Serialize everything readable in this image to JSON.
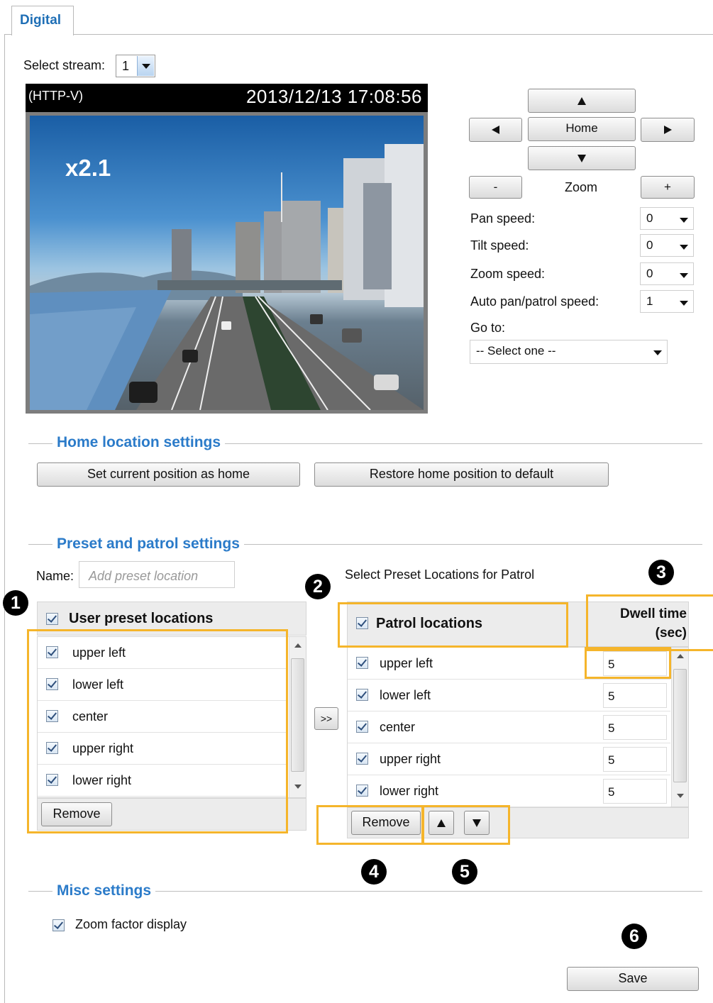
{
  "tab": {
    "label": "Digital"
  },
  "stream": {
    "label": "Select stream:",
    "value": "1"
  },
  "video": {
    "protocol": "(HTTP-V)",
    "timestamp": "2013/12/13  17:08:56",
    "zoom_factor": "x2.1"
  },
  "ptz": {
    "home_label": "Home",
    "zoom_label": "Zoom",
    "minus_label": "-",
    "plus_label": "+",
    "pan_speed": {
      "label": "Pan speed:",
      "value": "0"
    },
    "tilt_speed": {
      "label": "Tilt speed:",
      "value": "0"
    },
    "zoom_speed": {
      "label": "Zoom speed:",
      "value": "0"
    },
    "auto_speed": {
      "label": "Auto pan/patrol speed:",
      "value": "1"
    },
    "goto": {
      "label": "Go to:",
      "value": "-- Select one --"
    }
  },
  "home_location": {
    "title": "Home location settings",
    "set_button": "Set current position as home",
    "restore_button": "Restore home position to default"
  },
  "preset": {
    "title": "Preset and patrol settings",
    "name_label": "Name:",
    "name_placeholder": "Add preset location",
    "patrol_caption": "Select Preset Locations for Patrol",
    "user_header": "User preset locations",
    "user_items": [
      "upper left",
      "lower left",
      "center",
      "upper right",
      "lower right"
    ],
    "remove_label": "Remove",
    "add_label": ">>",
    "patrol_header": "Patrol locations",
    "dwell_header_1": "Dwell time",
    "dwell_header_2": "(sec)",
    "patrol_items": [
      {
        "name": "upper left",
        "dwell": "5"
      },
      {
        "name": "lower left",
        "dwell": "5"
      },
      {
        "name": "center",
        "dwell": "5"
      },
      {
        "name": "upper right",
        "dwell": "5"
      },
      {
        "name": "lower right",
        "dwell": "5"
      }
    ],
    "patrol_remove_label": "Remove"
  },
  "misc": {
    "title": "Misc settings",
    "zoom_display_label": "Zoom factor display"
  },
  "save_label": "Save",
  "badges": [
    "1",
    "2",
    "3",
    "4",
    "5",
    "6"
  ],
  "colors": {
    "section_title": "#2b7bc9",
    "highlight": "#f5b52b",
    "tab_text": "#1f6fb6"
  }
}
